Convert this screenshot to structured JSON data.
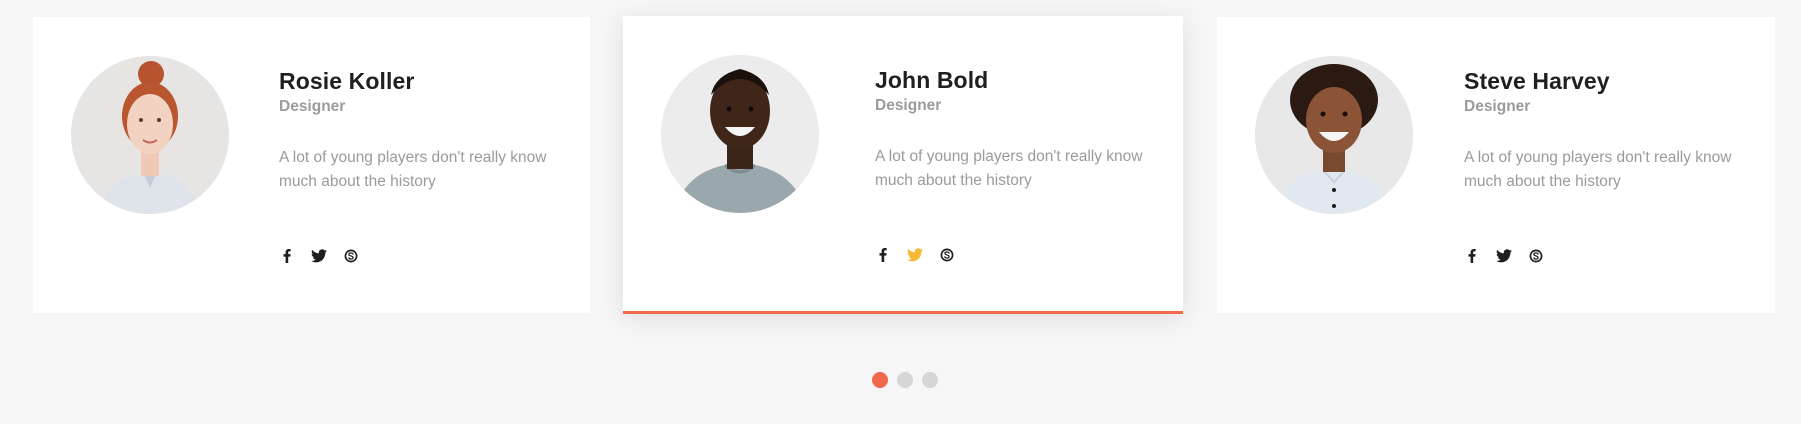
{
  "team": [
    {
      "name": "Rosie Koller",
      "role": "Designer",
      "description": "A lot of young players don't really know much about the history",
      "social": [
        "facebook-icon",
        "twitter-icon",
        "skype-icon"
      ],
      "active": false
    },
    {
      "name": "John Bold",
      "role": "Designer",
      "description": "A lot of young players don't really know much about the history",
      "social": [
        "facebook-icon",
        "twitter-icon",
        "skype-icon"
      ],
      "active": true
    },
    {
      "name": "Steve Harvey",
      "role": "Designer",
      "description": "A lot of young players don't really know much about the history",
      "social": [
        "facebook-icon",
        "twitter-icon",
        "skype-icon"
      ],
      "active": false
    }
  ],
  "colors": {
    "accent": "#f26a4b",
    "twitter_hover": "#f7b733",
    "dot_inactive": "#d6d6d6"
  },
  "pagination": {
    "pages": 3,
    "current": 1
  }
}
